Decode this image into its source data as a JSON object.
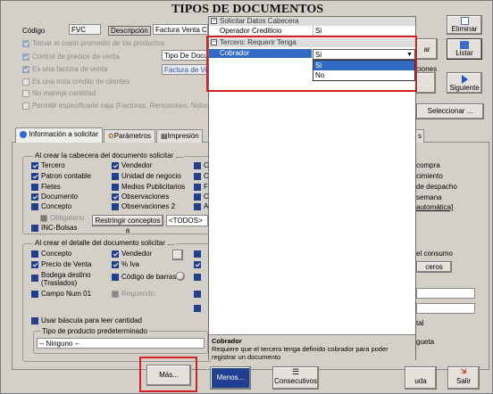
{
  "window_title": "TIPOS DE DOCUMENTOS",
  "header": {
    "codigo_label": "Código",
    "codigo_value": "FVC",
    "descripcion_label": "Descripción",
    "descripcion_value": "Factura Venta Co"
  },
  "options_left": [
    {
      "label": "Tomar el costo promedio de los productos",
      "checked": true
    },
    {
      "label": "Control de precios de venta",
      "checked": true
    },
    {
      "label": "Es una factura de venta",
      "checked": true
    },
    {
      "label": "Es una nota crédito de clientes",
      "checked": false
    },
    {
      "label": "No maneja cantidad",
      "checked": false
    },
    {
      "label": "Permitir especificarle caja  (Facturas, Remisiones, Notas Cr",
      "checked": false
    }
  ],
  "tipo_doc_value": "Tipo De Docum",
  "factura_value": "Factura de Ve",
  "right_buttons": {
    "eliminar": "Eliminar",
    "listar": "Listar",
    "siguiente": "Siguiente",
    "opciones_partial": "ciones",
    "seleccionar": "Seleccionar ..."
  },
  "tabs": [
    {
      "label": "Información a solicitar",
      "active": true
    },
    {
      "label": "Parámetros",
      "active": false
    },
    {
      "label": "Impresión",
      "active": false
    },
    {
      "label": "s",
      "active": false
    }
  ],
  "cabecera_group": {
    "title": "Al crear la cabecera del documento solicitar ....",
    "col1": [
      {
        "label": "Tercero",
        "state": "on"
      },
      {
        "label": "Patron contable",
        "state": "on"
      },
      {
        "label": "Fletes",
        "state": "blk"
      },
      {
        "label": "Documento",
        "state": "on"
      },
      {
        "label": "Concepto",
        "state": "blk"
      }
    ],
    "col2": [
      {
        "label": "Vendedor",
        "state": "on"
      },
      {
        "label": "Unidad de negocio",
        "state": "blk"
      },
      {
        "label": "Medios Publicitarios",
        "state": "blk"
      },
      {
        "label": "Observaciones",
        "state": "on"
      },
      {
        "label": "Observaciones 2",
        "state": "blk"
      }
    ],
    "col3_partial": [
      "C",
      "C",
      "F",
      "C",
      "A"
    ],
    "obligatorio": "Obligatorio",
    "restringir": "Restringir conceptos a",
    "todos": "<TODOS>",
    "inc_bolsas": "INC-Bolsas"
  },
  "detalle_group": {
    "title": "Al crear  el detalle del documento solicitar ....",
    "col1": [
      {
        "label": "Concepto",
        "state": "blk"
      },
      {
        "label": "Precio de Venta",
        "state": "on"
      },
      {
        "label": "Bodega destino\n(Traslados)",
        "state": "blk"
      },
      {
        "label": "Campo Num 01",
        "state": "blk"
      }
    ],
    "col2": [
      {
        "label": "Vendedor",
        "state": "on"
      },
      {
        "label": "% Iva",
        "state": "on"
      },
      {
        "label": "Código de barras",
        "state": "blk"
      },
      {
        "label": "Requerido",
        "state": "dis"
      }
    ],
    "usar_bascula": "Usar báscula para leer cantidad",
    "tipo_producto_label": "Tipo de producto predeterminado",
    "tipo_producto_value": "-- Ninguno --"
  },
  "right_partial": {
    "compra": "compra",
    "cimiento": "cimiento",
    "despacho": "de despacho",
    "semana": "semana",
    "automatica": "automática]",
    "consumo": "el consumo",
    "ceros": "ceros",
    "tal": "tal",
    "gueta": "gueta"
  },
  "bottom_buttons": {
    "mas": "Más...",
    "menos": "Menos...",
    "consecutivos": "Consecutivos",
    "ayuda": "uda",
    "salir": "Salir"
  },
  "property_grid": {
    "cat1": "Solicitar Datos Cabecera",
    "prop1_name": "Operador Crediticio",
    "prop1_value": "Si",
    "cat2": "Tercero: Requerir Tenga",
    "prop2_name": "Cobrador",
    "prop2_value": "Si",
    "options": [
      "Si",
      "No"
    ],
    "desc_title": "Cobrador",
    "desc_text": "Requiere que el tercero tenga definido cobrador para poder registrar un documento"
  }
}
